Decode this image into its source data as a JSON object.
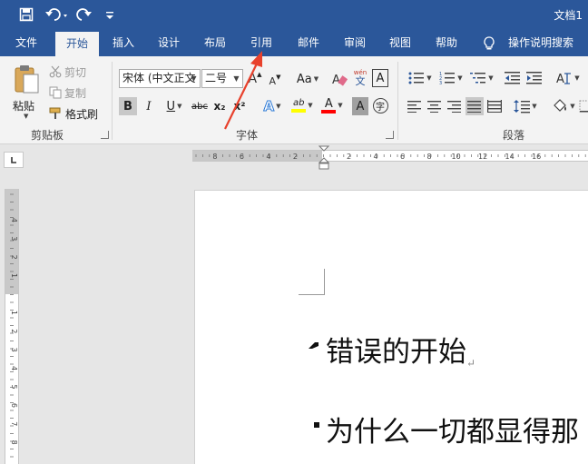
{
  "title_bar": {
    "document_title": "文档1"
  },
  "tabs": [
    {
      "label": "文件"
    },
    {
      "label": "开始"
    },
    {
      "label": "插入"
    },
    {
      "label": "设计"
    },
    {
      "label": "布局"
    },
    {
      "label": "引用"
    },
    {
      "label": "邮件"
    },
    {
      "label": "审阅"
    },
    {
      "label": "视图"
    },
    {
      "label": "帮助"
    }
  ],
  "tell_me": "操作说明搜索",
  "clipboard": {
    "paste": "粘贴",
    "cut": "剪切",
    "copy": "复制",
    "format_painter": "格式刷",
    "group": "剪贴板"
  },
  "font": {
    "font_name": "宋体 (中文正文",
    "font_size": "二号",
    "group": "字体",
    "bold": "B",
    "italic": "I",
    "underline": "U",
    "strike": "abc",
    "subscript": "x₂",
    "superscript": "x²",
    "grow": "A",
    "shrink": "A",
    "change_case": "Aa",
    "phonetic": "wén",
    "char_border": "A",
    "text_effect": "A",
    "highlight": "ab",
    "font_color": "A",
    "char_shading": "A",
    "enclose": "字"
  },
  "paragraph": {
    "group": "段落"
  },
  "ruler": {
    "h_labels": [
      "8",
      "6",
      "4",
      "2",
      "2",
      "4",
      "6",
      "8",
      "10",
      "12",
      "14",
      "16"
    ],
    "v_labels": [
      "4",
      "3",
      "2",
      "1",
      "1",
      "2",
      "3",
      "4",
      "5",
      "6",
      "7",
      "8"
    ]
  },
  "document": {
    "lines": [
      "错误的开始",
      "为什么一切都显得那"
    ],
    "paragraph_mark": "↵"
  },
  "colors": {
    "accent": "#2b579a",
    "ribbon": "#f3f3f3",
    "annotation_arrow": "#e8412c",
    "highlight_yellow": "#ffff00",
    "font_red": "#ff0000"
  }
}
